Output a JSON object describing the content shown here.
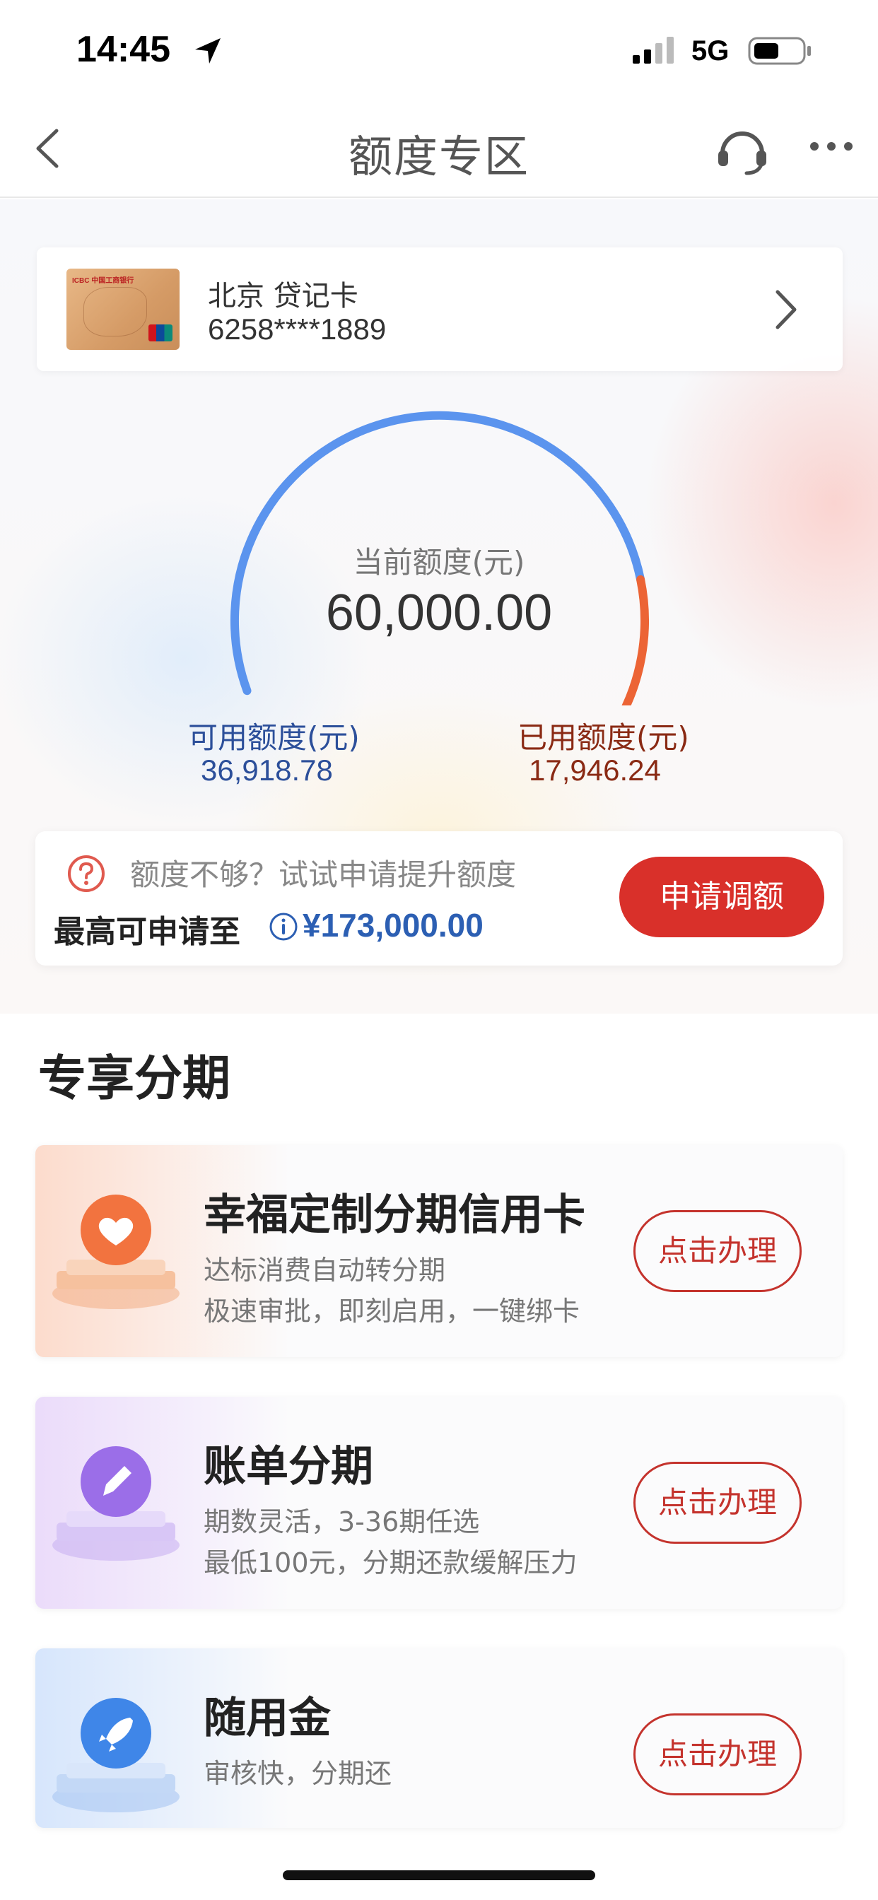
{
  "status_bar": {
    "time": "14:45",
    "network": "5G"
  },
  "nav": {
    "title": "额度专区"
  },
  "card": {
    "name": "北京 贷记卡",
    "number": "6258****1889",
    "thumb_bank_text": "ICBC 中国工商银行"
  },
  "gauge": {
    "label": "当前额度(元)",
    "value": "60,000.00",
    "available_label": "可用额度(元)",
    "available_value": "36,918.78",
    "used_label": "已用额度(元)",
    "used_value": "17,946.24",
    "available_fraction": 0.673,
    "colors": {
      "available": "#5b94ee",
      "used": "#ec6435"
    }
  },
  "raise": {
    "hint": "额度不够？试试申请提升额度",
    "max_label": "最高可申请至",
    "max_value": "¥173,000.00",
    "button": "申请调额"
  },
  "section": {
    "title": "专享分期",
    "items": [
      {
        "title": "幸福定制分期信用卡",
        "line1": "达标消费自动转分期",
        "line2": "极速审批，即刻启用，一键绑卡",
        "button": "点击办理",
        "icon": "heart-icon"
      },
      {
        "title": "账单分期",
        "line1": "期数灵活，3-36期任选",
        "line2": "最低100元，分期还款缓解压力",
        "button": "点击办理",
        "icon": "pencil-icon"
      },
      {
        "title": "随用金",
        "line1": "审核快，分期还",
        "button": "点击办理",
        "icon": "rocket-icon"
      }
    ]
  }
}
